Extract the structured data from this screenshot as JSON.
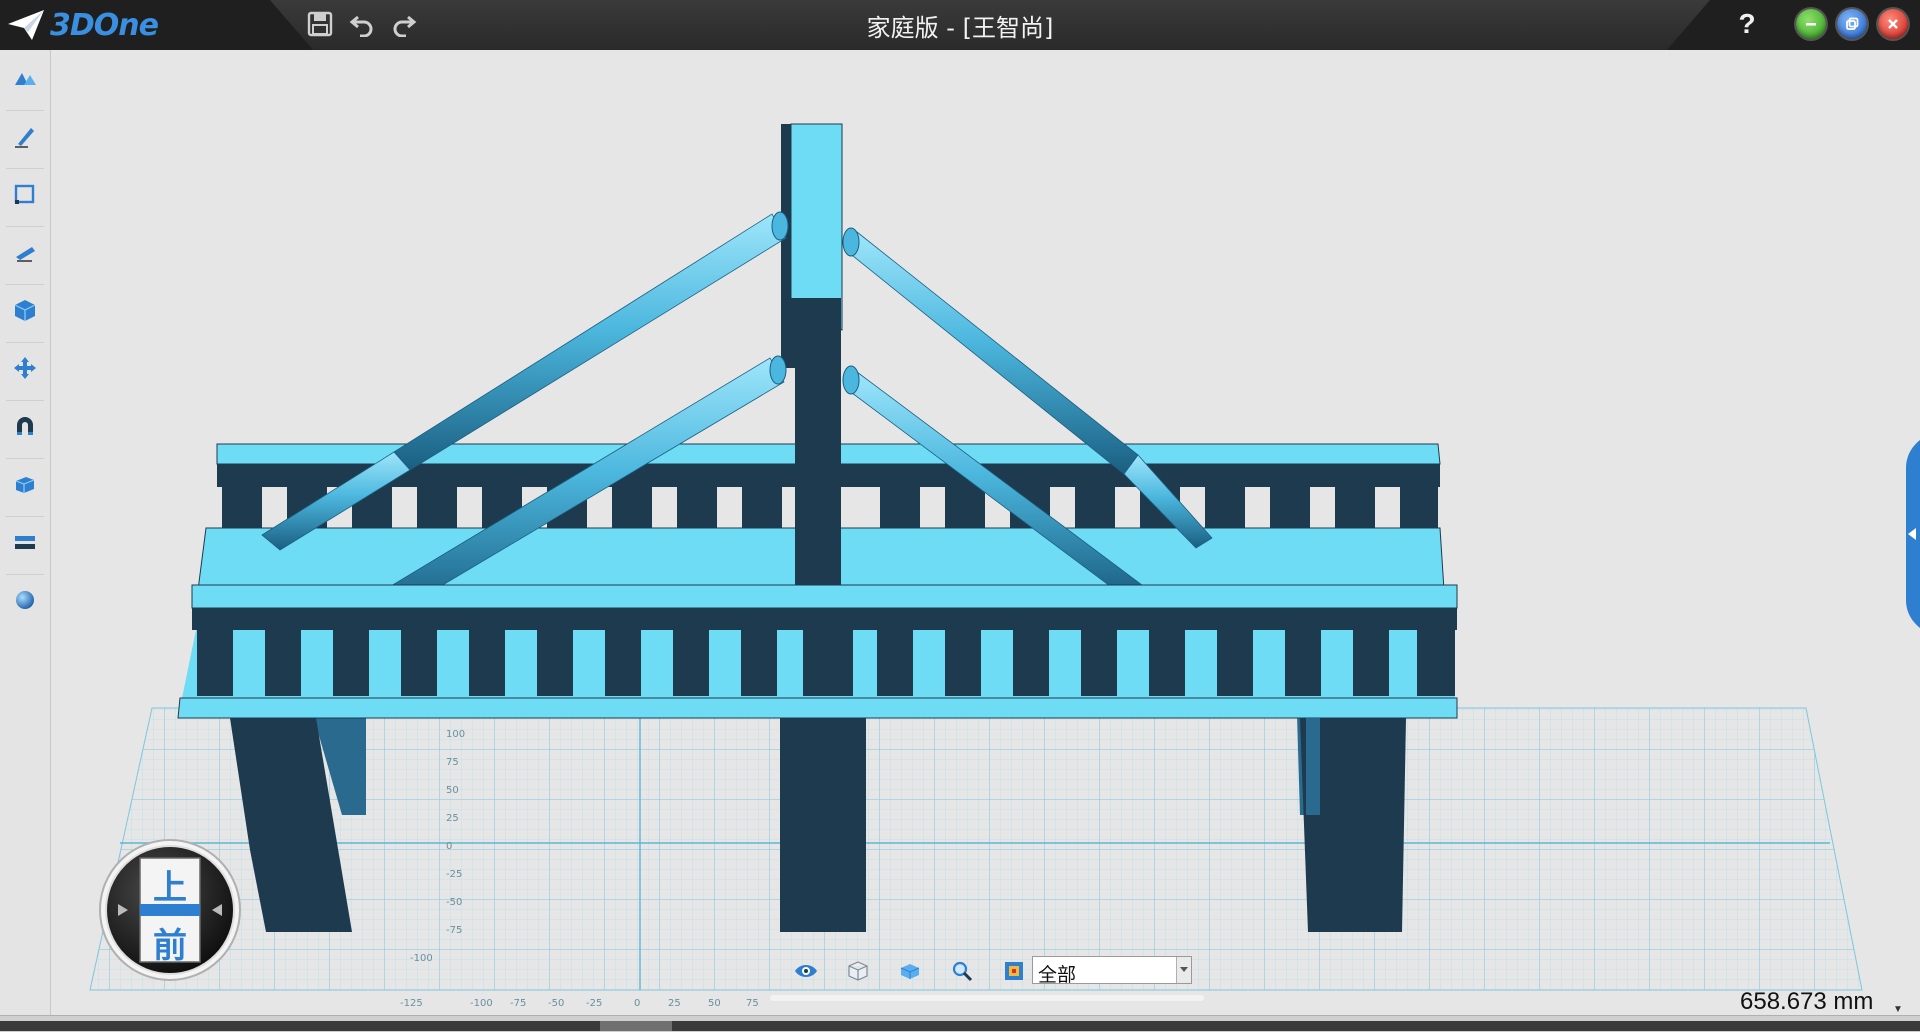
{
  "app": {
    "logo_text": "3DOne",
    "title": "家庭版 - [王智尚]",
    "help_label": "?"
  },
  "quick_access": [
    {
      "name": "save-icon"
    },
    {
      "name": "undo-icon"
    },
    {
      "name": "redo-icon"
    }
  ],
  "window_controls": {
    "minimize_color": "#3fae2a",
    "restore_color": "#2f6fd6",
    "close_color": "#d9302b"
  },
  "left_toolbar": [
    {
      "name": "basic-solids-icon"
    },
    {
      "name": "sketch-icon"
    },
    {
      "name": "sketch-edit-icon"
    },
    {
      "name": "special-feature-icon"
    },
    {
      "name": "feature-modeling-icon"
    },
    {
      "name": "base-edit-icon"
    },
    {
      "name": "magnet-icon"
    },
    {
      "name": "combine-edit-icon"
    },
    {
      "name": "assembly-icon"
    },
    {
      "name": "sphere-icon"
    }
  ],
  "viewcube": {
    "top_label": "上",
    "front_label": "前"
  },
  "grid": {
    "x_labels": [
      "-125",
      "-100",
      "-75",
      "-50",
      "-25",
      "0",
      "25",
      "50",
      "75"
    ],
    "y_labels": [
      "100",
      "75",
      "50",
      "25",
      "0",
      "-25",
      "-50",
      "-75",
      "-100"
    ]
  },
  "bottom_toolbar": {
    "tools": [
      "view-display-icon",
      "wireframe-cube-icon",
      "shaded-cube-icon",
      "zoom-icon",
      "render-mode-icon"
    ],
    "filter": {
      "value": "全部"
    }
  },
  "scale_readout": "658.673 mm",
  "colors": {
    "model_light": "#6fdcf5",
    "model_dark": "#1e3a4e",
    "accent": "#2f7fd0",
    "grid": "#8fd0e6"
  }
}
